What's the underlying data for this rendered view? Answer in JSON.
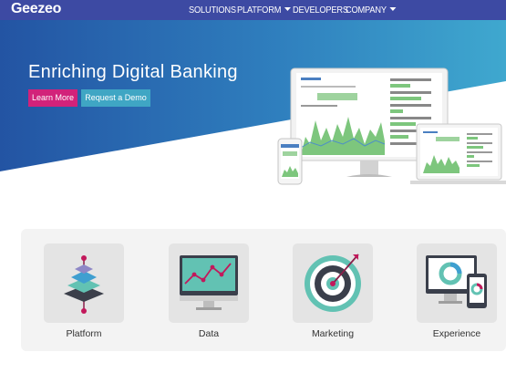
{
  "nav": {
    "logo": "Geezeo",
    "items": [
      {
        "label": "SOLUTIONS",
        "dropdown": false
      },
      {
        "label": "PLATFORM",
        "dropdown": true
      },
      {
        "label": "DEVELOPERS",
        "dropdown": false
      },
      {
        "label": "COMPANY",
        "dropdown": true
      }
    ]
  },
  "hero": {
    "title": "Enriching Digital Banking",
    "learn_more": "Learn More",
    "request_demo": "Request a Demo"
  },
  "features": [
    {
      "label": "Platform",
      "icon": "layers-icon"
    },
    {
      "label": "Data",
      "icon": "monitor-chart-icon"
    },
    {
      "label": "Marketing",
      "icon": "target-icon"
    },
    {
      "label": "Experience",
      "icon": "devices-icon"
    }
  ],
  "colors": {
    "nav_bg": "#3d4aa3",
    "hero_dark": "#2354a3",
    "hero_light": "#3fa8cf",
    "accent_pink": "#d2227a",
    "accent_teal": "#3fa6c4",
    "chart_green": "#7dc67d"
  }
}
